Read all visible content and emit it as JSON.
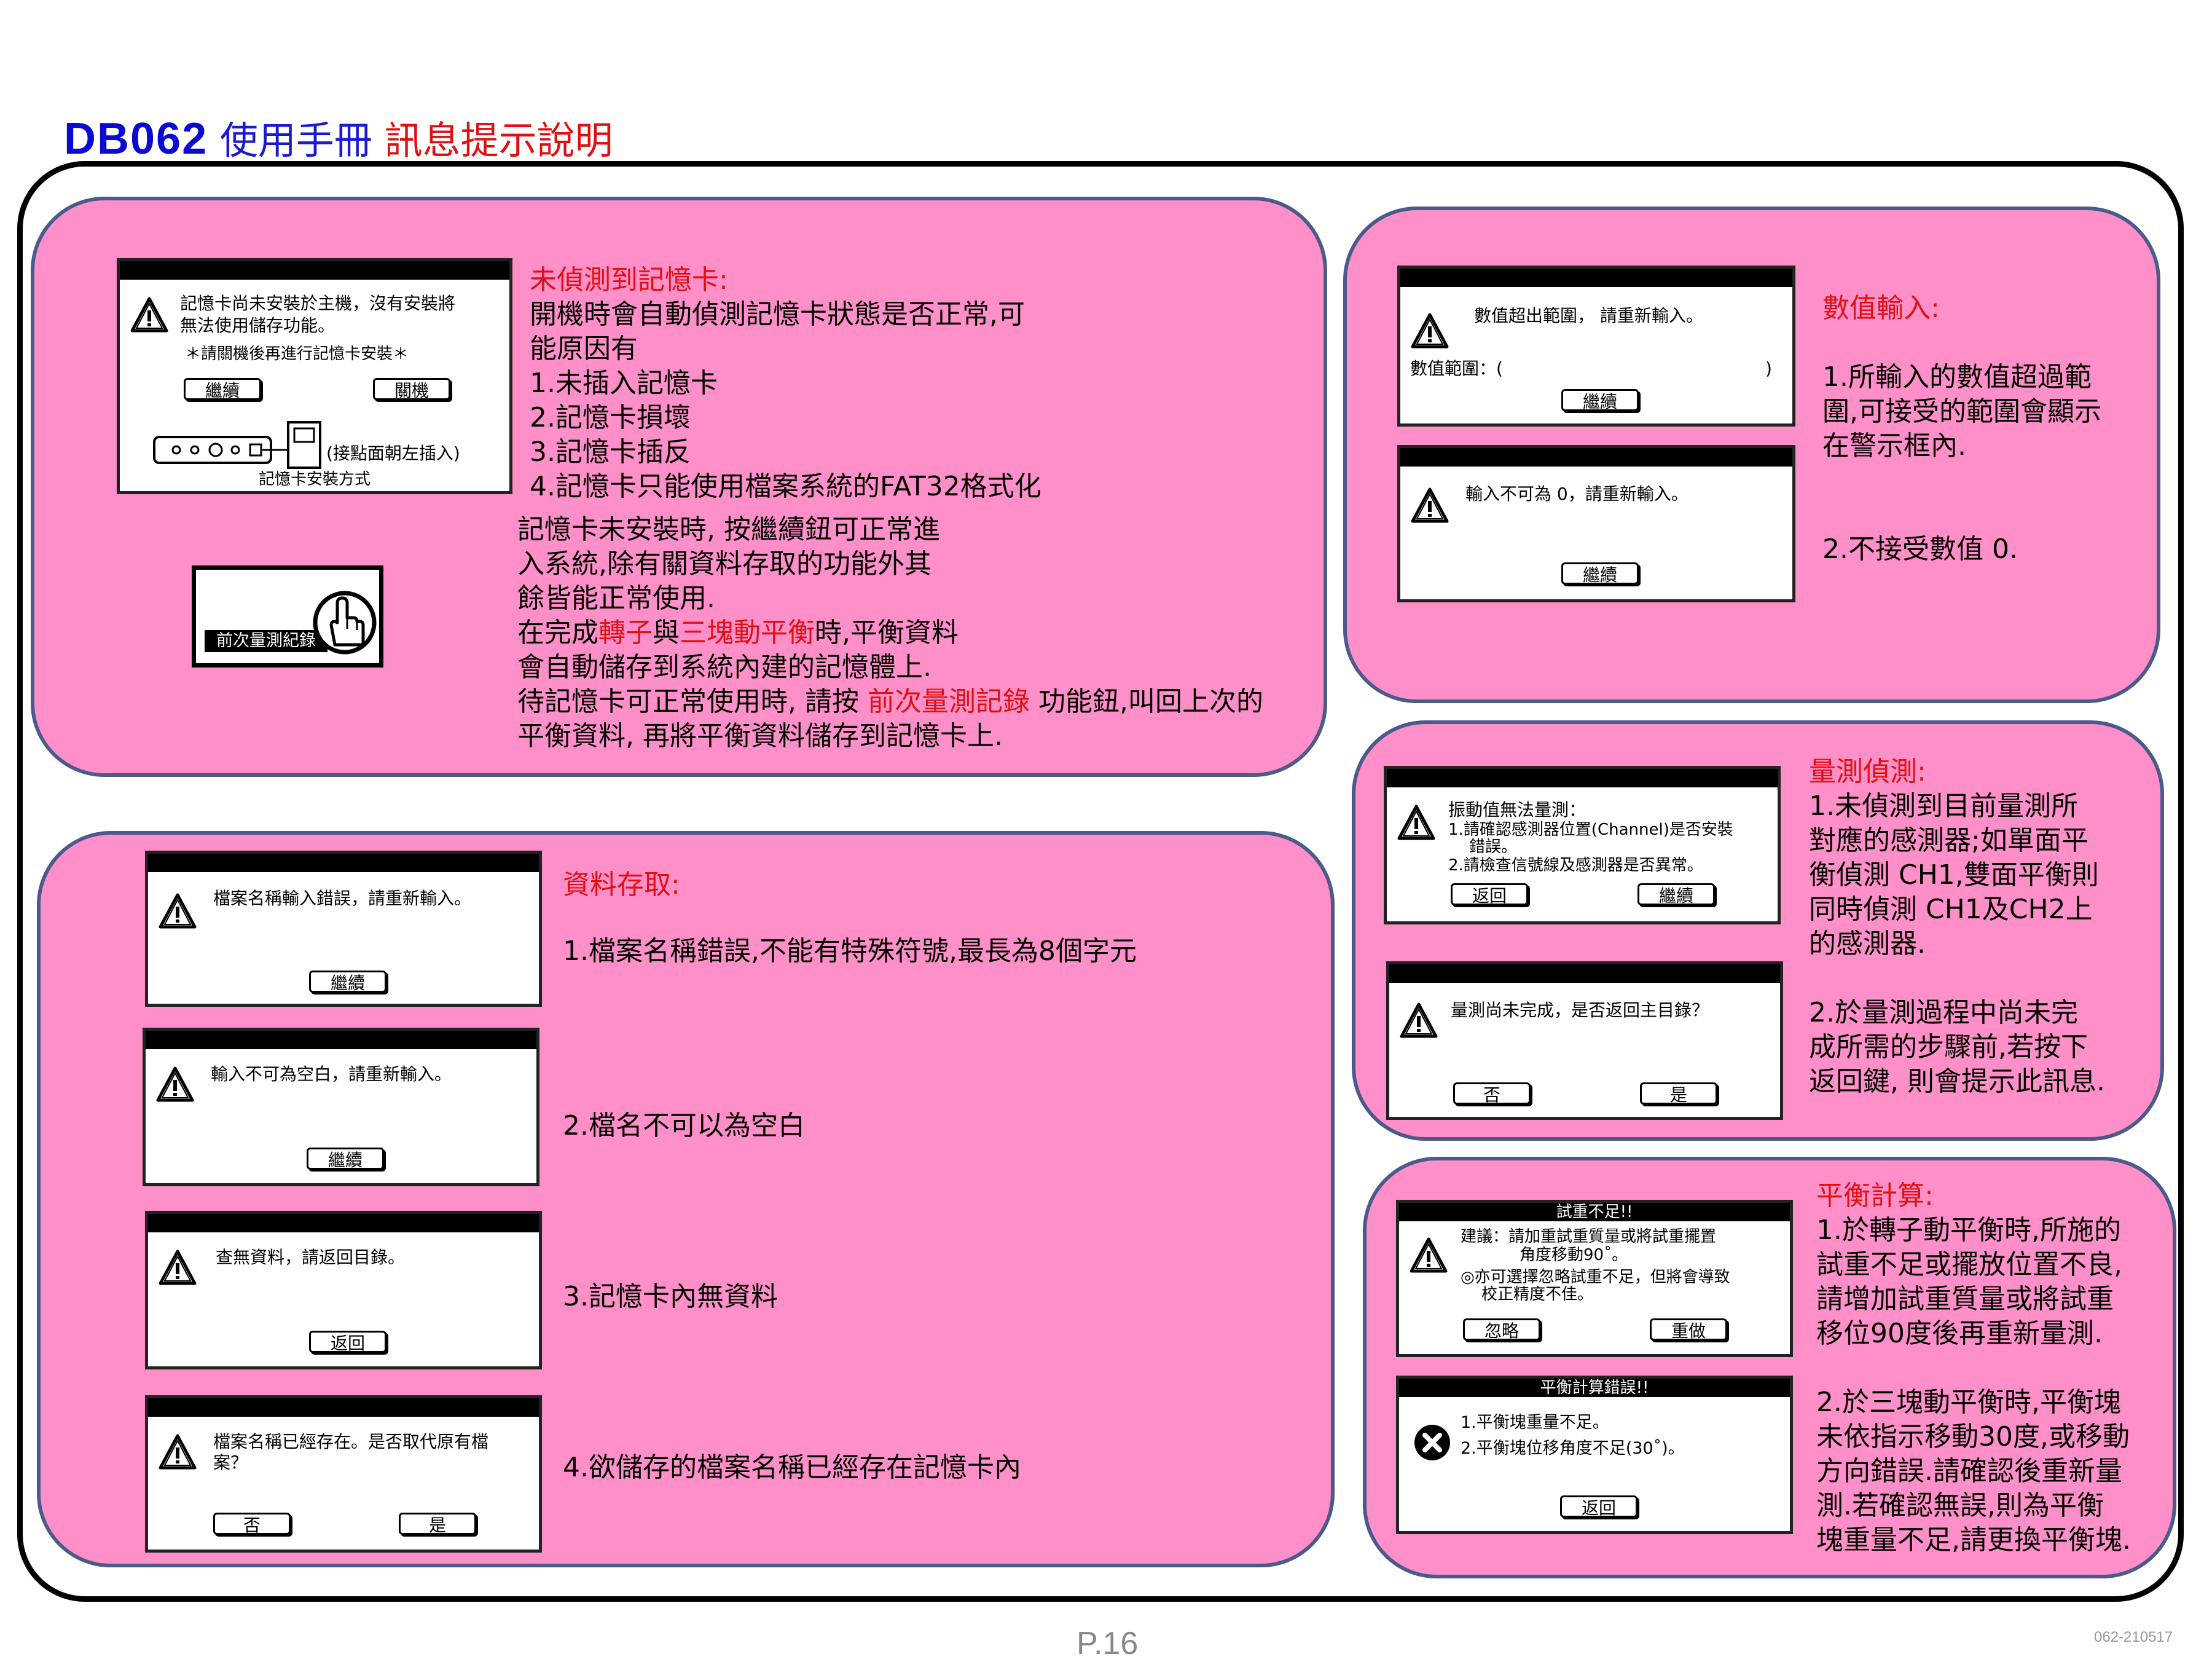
{
  "header": {
    "model": "DB062",
    "manual": "使用手冊",
    "section": "訊息提示說明"
  },
  "footer": {
    "page": "P.16",
    "code": "062-210517"
  },
  "memory_card": {
    "dialog": {
      "line1": "記憶卡尚未安裝於主機，沒有安裝將",
      "line2": "無法使用儲存功能。",
      "note": "＊請關機後再進行記憶卡安裝＊",
      "btn_continue": "繼續",
      "btn_shutdown": "關機",
      "insert_hint": "(接點面朝左插入)",
      "install_caption": "記憶卡安裝方式"
    },
    "prev_button": "前次量測紀錄",
    "heading": "未偵測到記憶卡:",
    "lines": [
      "開機時會自動偵測記憶卡狀態是否正常,可",
      "能原因有",
      "1.未插入記憶卡",
      "2.記憶卡損壞",
      "3.記憶卡插反",
      "4.記憶卡只能使用檔案系統的FAT32格式化"
    ],
    "body1": [
      "記憶卡未安裝時, 按繼續鈕可正常進",
      "入系統,除有關資料存取的功能外其",
      "餘皆能正常使用."
    ],
    "body2": {
      "a": "在完成",
      "b": "轉子",
      "c": "與",
      "d": "三塊動平衡",
      "e": "時,平衡資料"
    },
    "body3": "會自動儲存到系統內建的記憶體上.",
    "body4": {
      "a": "待記憶卡可正常使用時, 請按 ",
      "b": "前次量測記錄",
      "c": " 功能鈕,叫回上次的"
    },
    "body5": "平衡資料, 再將平衡資料儲存到記憶卡上."
  },
  "numeric": {
    "dialog1": {
      "msg": "數值超出範圍， 請重新輸入。",
      "range_label": "數值範圍：(",
      "range_close": ")",
      "btn": "繼續"
    },
    "dialog2": {
      "msg": "輸入不可為 0，請重新輸入。",
      "btn": "繼續"
    },
    "heading": "數值輸入:",
    "p1": [
      "1.所輸入的數值超過範",
      "圍,可接受的範圍會顯示",
      "在警示框內."
    ],
    "p2": "2.不接受數值 0."
  },
  "data_access": {
    "heading": "資料存取:",
    "items": [
      {
        "msg": "檔案名稱輸入錯誤，請重新輸入。",
        "btn": "繼續",
        "desc": "1.檔案名稱錯誤,不能有特殊符號,最長為8個字元"
      },
      {
        "msg": "輸入不可為空白，請重新輸入。",
        "btn": "繼續",
        "desc": "2.檔名不可以為空白"
      },
      {
        "msg": "查無資料，請返回目錄。",
        "btn": "返回",
        "desc": "3.記憶卡內無資料"
      },
      {
        "msg": "檔案名稱已經存在。是否取代原有檔",
        "msg2": "案？",
        "btn_no": "否",
        "btn_yes": "是",
        "desc": "4.欲儲存的檔案名稱已經存在記憶卡內"
      }
    ]
  },
  "detection": {
    "dialog1": {
      "title": "振動值無法量測：",
      "l1": "1.請確認感測器位置(Channel)是否安裝",
      "l2": "錯誤。",
      "l3": "2.請檢查信號線及感測器是否異常。",
      "btn_back": "返回",
      "btn_continue": "繼續"
    },
    "dialog2": {
      "msg": "量測尚未完成，是否返回主目錄？",
      "btn_no": "否",
      "btn_yes": "是"
    },
    "heading": "量測偵測:",
    "p1": [
      "1.未偵測到目前量測所",
      "對應的感測器;如單面平",
      "衡偵測 CH1,雙面平衡則",
      "同時偵測 CH1及CH2上",
      "的感測器."
    ],
    "p2": [
      "2.於量測過程中尚未完",
      "成所需的步驟前,若按下",
      "返回鍵, 則會提示此訊息."
    ]
  },
  "balance": {
    "dialog1": {
      "title": "試重不足!!",
      "l1": "建議：請加重試重質量或將試重擺置",
      "l2": "角度移動90˚。",
      "l3": "◎亦可選擇忽略試重不足，但將會導致",
      "l4": "校正精度不佳。",
      "btn_ignore": "忽略",
      "btn_redo": "重做"
    },
    "dialog2": {
      "title": "平衡計算錯誤!!",
      "l1": "1.平衡塊重量不足。",
      "l2": "2.平衡塊位移角度不足(30˚)。",
      "btn": "返回"
    },
    "heading": "平衡計算:",
    "p1": [
      "1.於轉子動平衡時,所施的",
      "試重不足或擺放位置不良,",
      "請增加試重質量或將試重",
      "移位90度後再重新量測."
    ],
    "p2": [
      "2.於三塊動平衡時,平衡塊",
      "未依指示移動30度,或移動",
      "方向錯誤.請確認後重新量",
      "測.若確認無誤,則為平衡",
      "塊重量不足,請更換平衡塊."
    ]
  }
}
